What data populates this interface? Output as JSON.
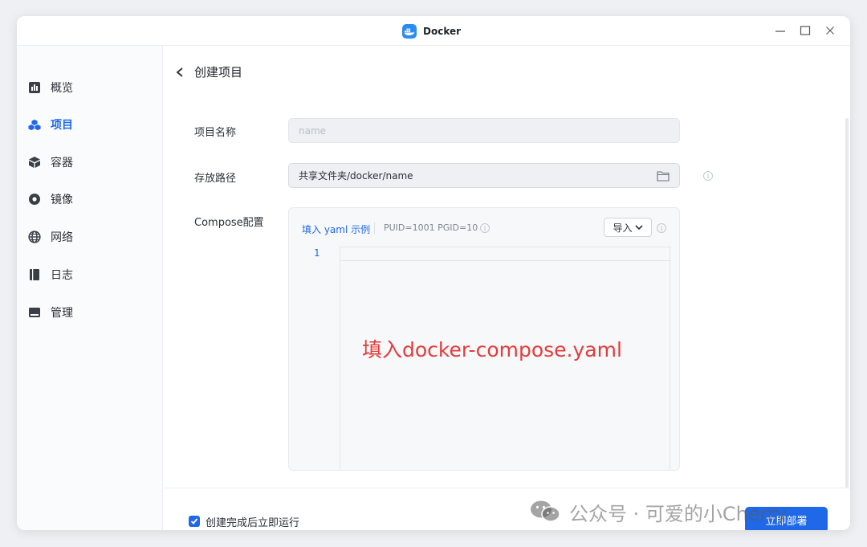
{
  "window": {
    "title": "Docker"
  },
  "sidebar": {
    "items": [
      {
        "label": "概览",
        "icon": "chart-bar-icon"
      },
      {
        "label": "项目",
        "icon": "cubes-icon",
        "active": true
      },
      {
        "label": "容器",
        "icon": "box-icon"
      },
      {
        "label": "镜像",
        "icon": "disc-icon"
      },
      {
        "label": "网络",
        "icon": "globe-icon"
      },
      {
        "label": "日志",
        "icon": "book-icon"
      },
      {
        "label": "管理",
        "icon": "panel-icon"
      }
    ]
  },
  "page": {
    "title": "创建项目"
  },
  "form": {
    "name_label": "项目名称",
    "name_placeholder": "name",
    "path_label": "存放路径",
    "path_value": "共享文件夹/docker/name",
    "compose_label": "Compose配置",
    "yaml_example_link": "填入 yaml 示例",
    "puid_text": "PUID=1001 PGID=10",
    "import_label": "导入",
    "editor_line_number": "1",
    "editor_overlay": "填入docker-compose.yaml"
  },
  "footer": {
    "auto_run_label": "创建完成后立即运行",
    "auto_run_checked": true,
    "deploy_label": "立即部署"
  },
  "watermark": {
    "text": "公众号 · 可爱的小Cherry"
  },
  "colors": {
    "accent": "#1f68e8",
    "annotation": "#e23c3c",
    "background": "#eef0f3"
  }
}
